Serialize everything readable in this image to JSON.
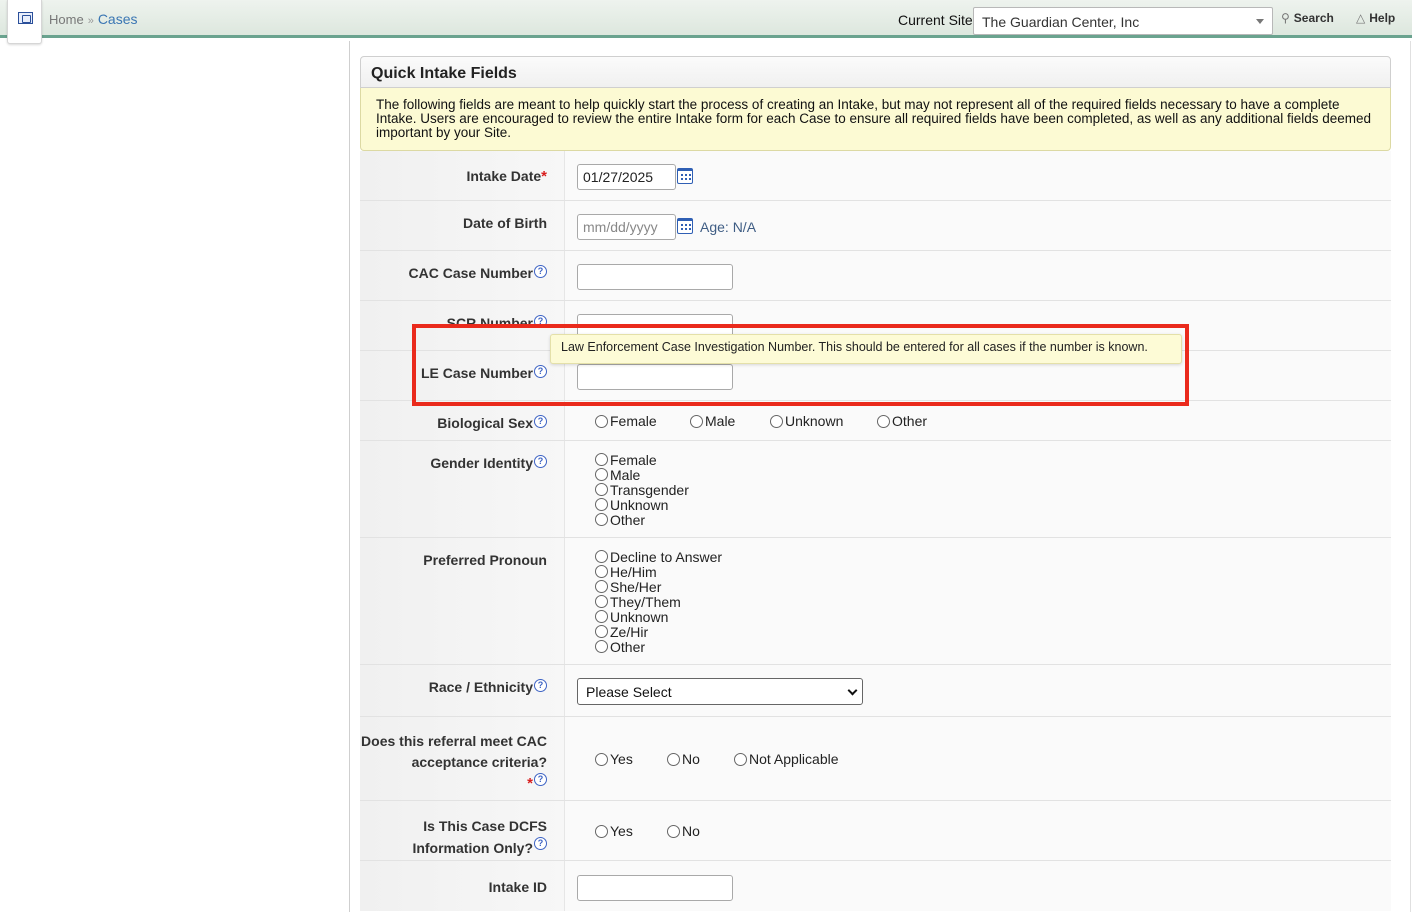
{
  "topbar": {
    "breadcrumb": {
      "home": "Home",
      "sep": "»",
      "current": "Cases"
    },
    "current_site_label": "Current Site",
    "current_site_value": "The Guardian Center, Inc",
    "search_label": "Search",
    "help_label": "Help"
  },
  "panel": {
    "title": "Quick Intake Fields",
    "notice": "The following fields are meant to help quickly start the process of creating an Intake, but may not represent all of the required fields necessary to have a complete Intake. Users are encouraged to review the entire Intake form for each Case to ensure all required fields have been completed, as well as any additional fields deemed important by your Site."
  },
  "fields": {
    "intake_date": {
      "label": "Intake Date",
      "value": "01/27/2025"
    },
    "dob": {
      "label": "Date of Birth",
      "placeholder": "mm/dd/yyyy",
      "age": "Age: N/A"
    },
    "cac_case_number": {
      "label": "CAC Case Number",
      "value": ""
    },
    "scr_number": {
      "label": "SCR Number",
      "value": ""
    },
    "le_case_number": {
      "label": "LE Case Number",
      "value": ""
    },
    "biological_sex": {
      "label": "Biological Sex",
      "options": [
        "Female",
        "Male",
        "Unknown",
        "Other"
      ]
    },
    "gender_identity": {
      "label": "Gender Identity",
      "options": [
        "Female",
        "Male",
        "Transgender",
        "Unknown",
        "Other"
      ]
    },
    "preferred_pronoun": {
      "label": "Preferred Pronoun",
      "options": [
        "Decline to Answer",
        "He/Him",
        "She/Her",
        "They/Them",
        "Unknown",
        "Ze/Hir",
        "Other"
      ]
    },
    "race_ethnicity": {
      "label": "Race / Ethnicity",
      "selected": "Please Select"
    },
    "cac_criteria": {
      "label_line1": "Does this referral meet CAC",
      "label_line2": "acceptance criteria?",
      "options": [
        "Yes",
        "No",
        "Not Applicable"
      ]
    },
    "dcfs_only": {
      "label_line1": "Is This Case DCFS",
      "label_line2": "Information Only?",
      "options": [
        "Yes",
        "No"
      ]
    },
    "intake_id": {
      "label": "Intake ID",
      "value": ""
    }
  },
  "tooltip": {
    "text": "Law Enforcement Case Investigation Number. This should be entered for all cases if the number is known."
  },
  "colors": {
    "topbar_accent": "#6aa38f",
    "link": "#3a76b3",
    "notice_bg": "#fcfad3",
    "required": "#d81e1e",
    "highlight": "#ea2a1c"
  }
}
